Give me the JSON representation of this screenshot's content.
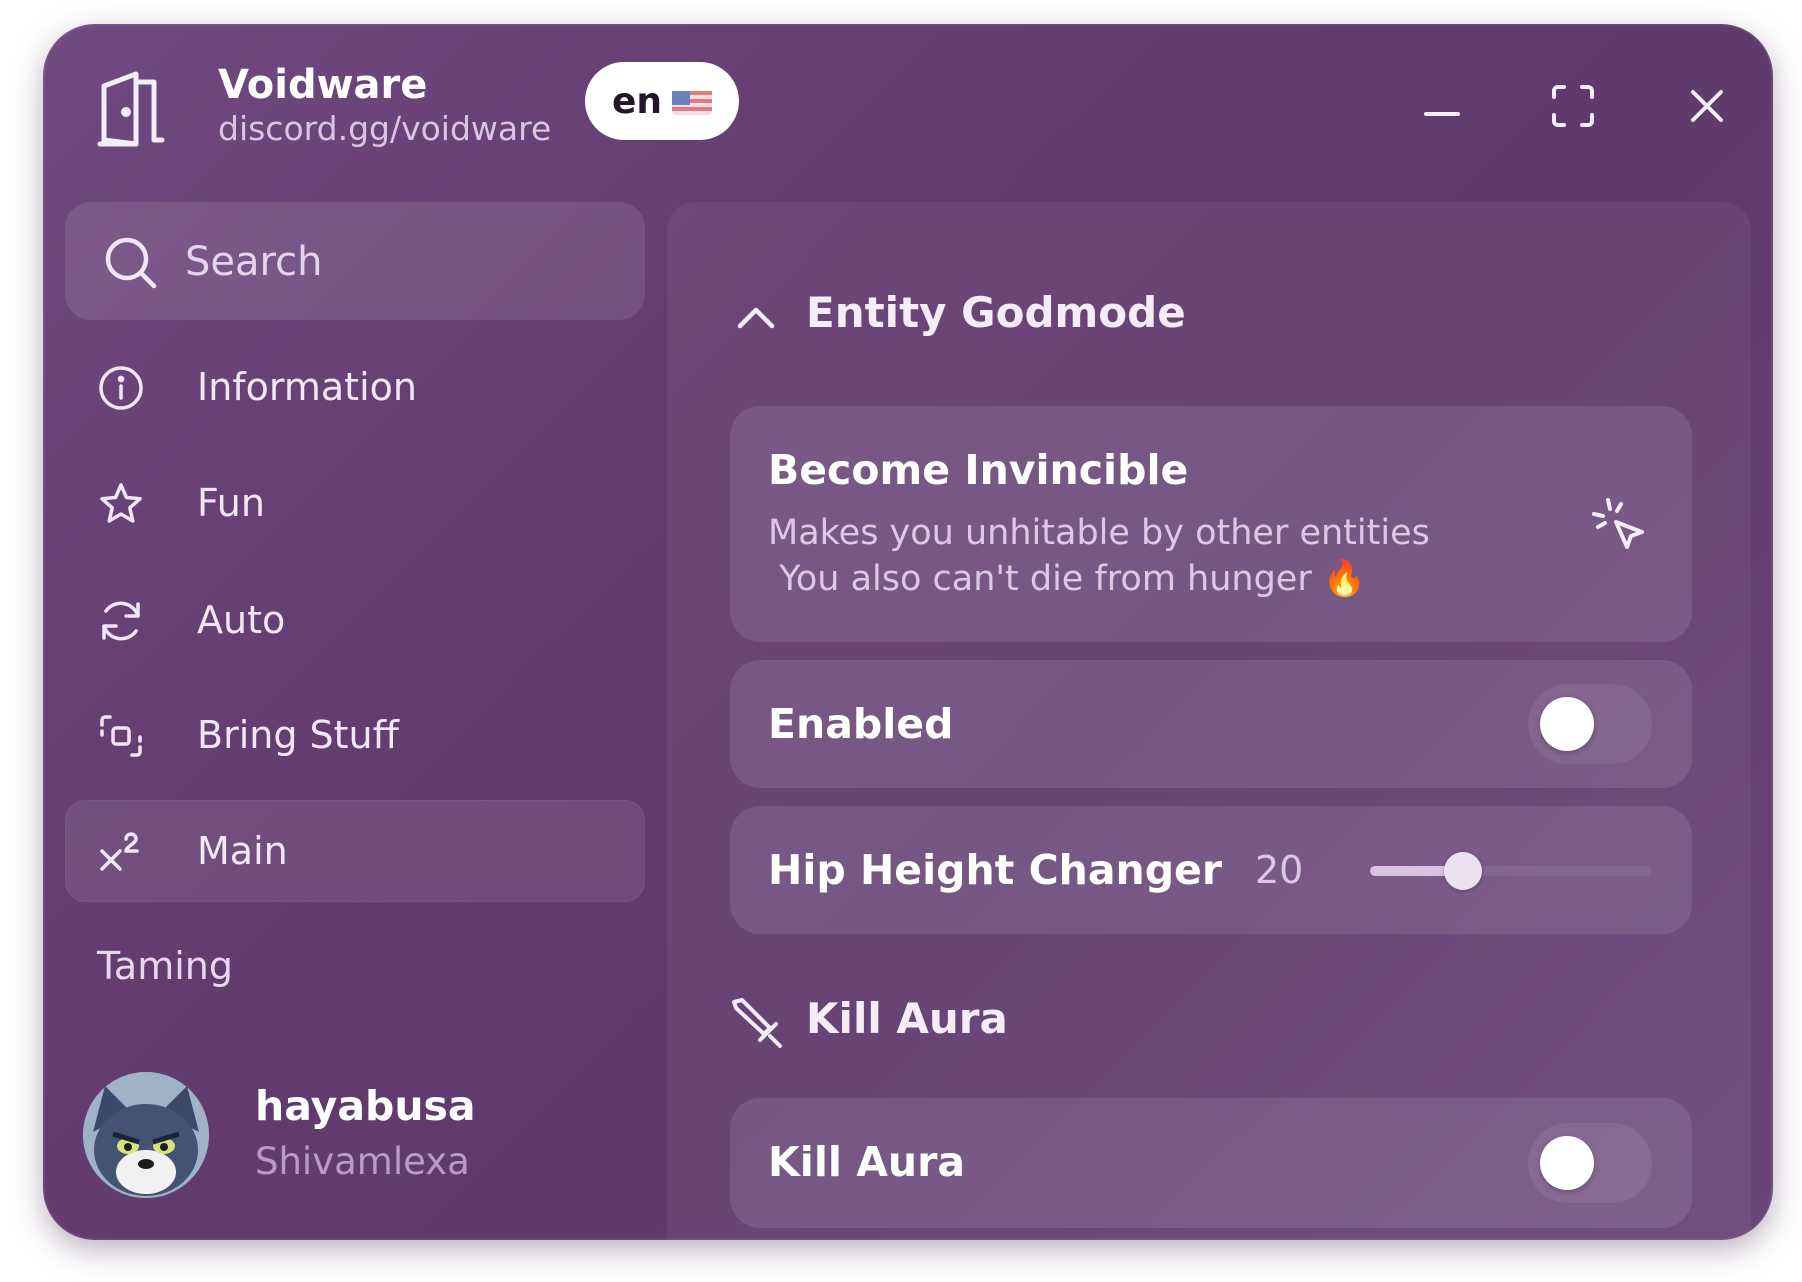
{
  "app": {
    "title": "Voidware",
    "subtitle": "discord.gg/voidware",
    "language": "en",
    "accent_color": "#633c70"
  },
  "window_controls": {
    "icons": [
      "minimize-icon",
      "maximize-icon",
      "close-icon"
    ]
  },
  "sidebar": {
    "search": {
      "placeholder": "Search",
      "value": ""
    },
    "items": [
      {
        "label": "Information",
        "icon": "info-icon"
      },
      {
        "label": "Fun",
        "icon": "star-icon"
      },
      {
        "label": "Auto",
        "icon": "refresh-icon"
      },
      {
        "label": "Bring Stuff",
        "icon": "copy-icon"
      },
      {
        "label": "Main",
        "icon": "superscript-icon",
        "active": true
      }
    ],
    "section_label": "Taming",
    "user": {
      "name": "hayabusa",
      "handle": "Shivamlexa"
    }
  },
  "main": {
    "sections": [
      {
        "title": "Entity Godmode",
        "icon": "chevron-up-icon",
        "cards": [
          {
            "type": "button",
            "title": "Become Invincible",
            "description": "Makes you unhitable by other entities\n You also can't die from hunger 🔥",
            "icon": "cursor-click-icon"
          },
          {
            "type": "toggle",
            "title": "Enabled",
            "value": false
          },
          {
            "type": "slider",
            "title": "Hip Height Changer",
            "value_label": "20",
            "fraction": 0.33
          }
        ]
      },
      {
        "title": "Kill Aura",
        "icon": "sword-icon",
        "cards": [
          {
            "type": "toggle",
            "title": "Kill Aura",
            "value": false
          }
        ]
      }
    ]
  }
}
